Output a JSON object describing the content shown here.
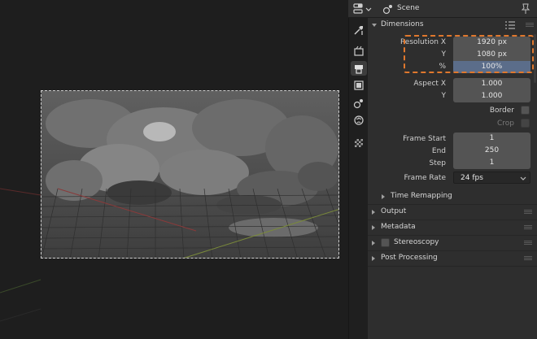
{
  "header": {
    "title": "Scene"
  },
  "tabs": [
    {
      "name": "tool-tab",
      "icon": "tool-icon"
    },
    {
      "name": "render-tab",
      "icon": "render-icon"
    },
    {
      "name": "output-tab",
      "icon": "printer-icon"
    },
    {
      "name": "view-layer-tab",
      "icon": "image-icon"
    },
    {
      "name": "scene-tab",
      "icon": "scene-icon"
    },
    {
      "name": "world-tab",
      "icon": "world-icon"
    },
    {
      "name": "texture-tab",
      "icon": "checker-icon"
    }
  ],
  "dimensions": {
    "title": "Dimensions",
    "resolution_x_label": "Resolution X",
    "resolution_x": "1920 px",
    "resolution_y_label": "Y",
    "resolution_y": "1080 px",
    "percent_label": "%",
    "percent": "100%",
    "aspect_x_label": "Aspect X",
    "aspect_x": "1.000",
    "aspect_y_label": "Y",
    "aspect_y": "1.000",
    "border_label": "Border",
    "crop_label": "Crop",
    "frame_start_label": "Frame Start",
    "frame_start": "1",
    "frame_end_label": "End",
    "frame_end": "250",
    "frame_step_label": "Step",
    "frame_step": "1",
    "frame_rate_label": "Frame Rate",
    "frame_rate": "24 fps",
    "time_remapping": "Time Remapping"
  },
  "sections": {
    "output": "Output",
    "metadata": "Metadata",
    "stereoscopy": "Stereoscopy",
    "post_processing": "Post Processing"
  }
}
